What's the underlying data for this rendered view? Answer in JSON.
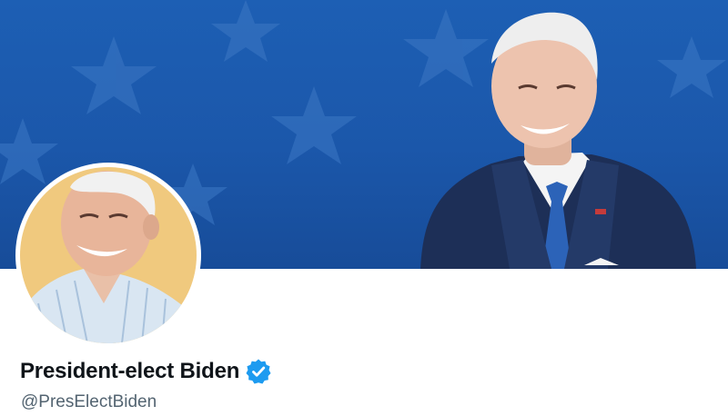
{
  "profile": {
    "display_name": "President-elect Biden",
    "handle": "@PresElectBiden",
    "verified": true
  },
  "banner": {
    "background_color": "#1b57aa",
    "star_color": "#3f7ac6",
    "suit_color": "#1d2f57",
    "tie_color": "#2c63b8"
  },
  "avatar": {
    "background_color": "#f0c97e",
    "shirt_color": "#d9e6f2"
  },
  "icons": {
    "verified": "verified-badge-icon"
  },
  "colors": {
    "verified_blue": "#1d9bf0",
    "name_text": "#0f1419",
    "handle_text": "#536471"
  }
}
